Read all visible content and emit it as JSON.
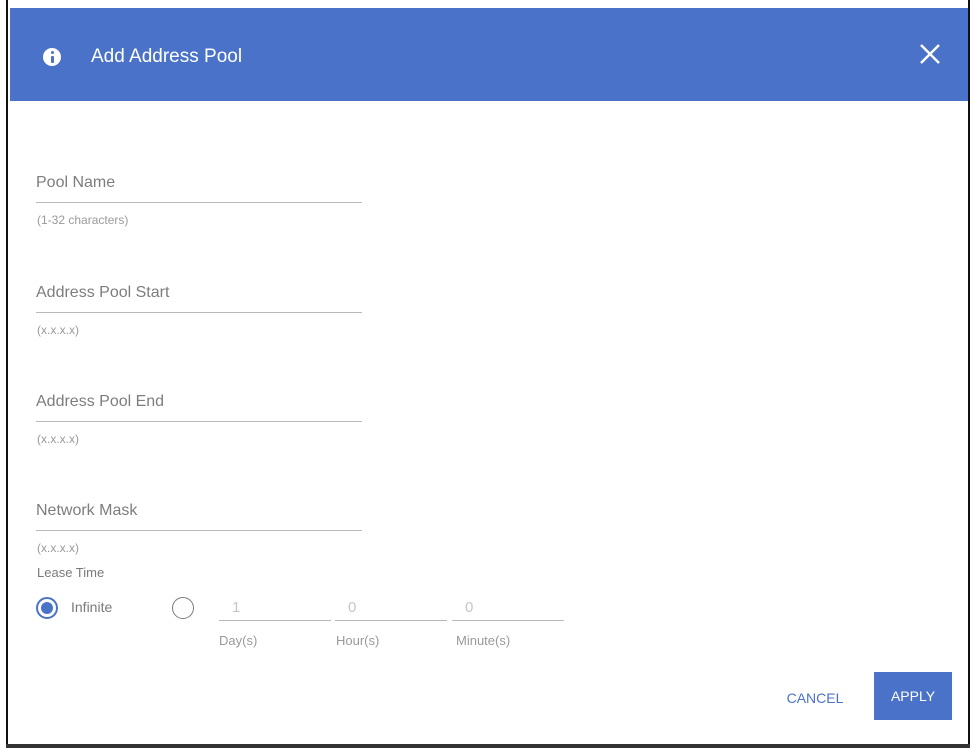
{
  "dialog": {
    "title": "Add Address Pool",
    "icon": "info-icon",
    "close_icon": "close-icon",
    "header_color": "#4a72c9"
  },
  "fields": {
    "pool_name": {
      "label": "Pool Name",
      "hint": "(1-32 characters)"
    },
    "pool_start": {
      "label": "Address Pool Start",
      "hint": "(x.x.x.x)"
    },
    "pool_end": {
      "label": "Address Pool End",
      "hint": "(x.x.x.x)"
    },
    "network_mask": {
      "label": "Network Mask",
      "hint": "(x.x.x.x)"
    }
  },
  "lease": {
    "label": "Lease Time",
    "infinite_label": "Infinite",
    "selected": "Infinite",
    "days": {
      "value": "1",
      "unit": "Day(s)"
    },
    "hours": {
      "value": "0",
      "unit": "Hour(s)"
    },
    "minutes": {
      "value": "0",
      "unit": "Minute(s)"
    }
  },
  "buttons": {
    "cancel": "CANCEL",
    "apply": "APPLY"
  }
}
